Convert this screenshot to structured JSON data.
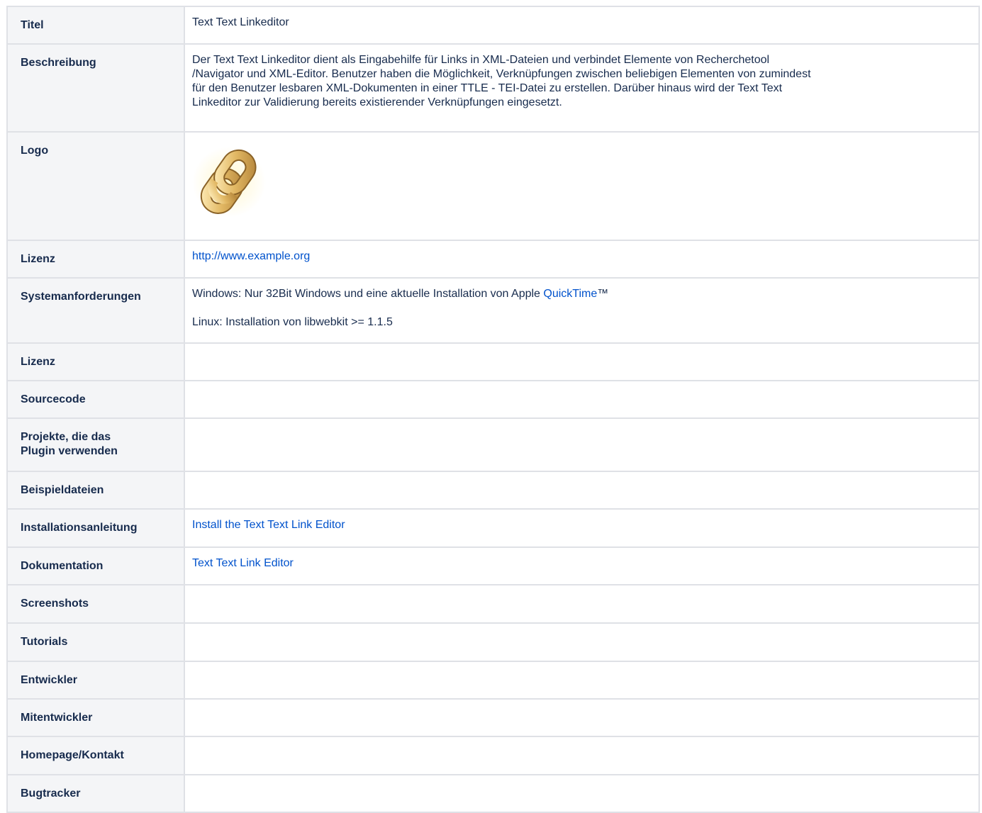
{
  "rows": {
    "titel": {
      "key": "Titel",
      "value": "Text Text Linkeditor"
    },
    "beschreibung": {
      "key": "Beschreibung",
      "value_line1": "Der Text Text Linkeditor dient als Eingabehilfe für Links in XML-Dateien und verbindet Elemente von Recherchetool",
      "value_line2": "/Navigator und XML-Editor. Benutzer haben die Möglichkeit, Verknüpfungen zwischen beliebigen Elementen von zumindest",
      "value_line3": "für den Benutzer lesbaren XML-Dokumenten in einer TTLE - TEI-Datei zu erstellen. Darüber hinaus wird der Text Text",
      "value_line4": "Linkeditor zur Validierung bereits existierender Verknüpfungen eingesetzt."
    },
    "logo": {
      "key": "Logo",
      "icon": "chain-link-icon"
    },
    "lizenz1": {
      "key": "Lizenz",
      "link": "http://www.example.org"
    },
    "system": {
      "key": "Systemanforderungen",
      "windows_prefix": "Windows: Nur 32Bit Windows und eine aktuelle Installation von Apple ",
      "windows_link": "QuickTime",
      "windows_suffix": "™",
      "linux": "Linux: Installation von libwebkit >= 1.1.5"
    },
    "lizenz2": {
      "key": "Lizenz"
    },
    "sourcecode": {
      "key": "Sourcecode"
    },
    "projekte": {
      "key_line1": "Projekte, die das",
      "key_line2": "Plugin verwenden"
    },
    "beispiel": {
      "key": "Beispieldateien"
    },
    "installation": {
      "key": "Installationsanleitung",
      "link": "Install the Text Text Link Editor"
    },
    "dokumentation": {
      "key": "Dokumentation",
      "link": "Text Text Link Editor"
    },
    "screenshots": {
      "key": "Screenshots"
    },
    "tutorials": {
      "key": "Tutorials"
    },
    "entwickler": {
      "key": "Entwickler"
    },
    "mitentwickler": {
      "key": "Mitentwickler"
    },
    "homepage": {
      "key": "Homepage/Kontakt"
    },
    "bugtracker": {
      "key": "Bugtracker"
    }
  },
  "colors": {
    "header_bg": "#f4f5f7",
    "border": "#dfe1e6",
    "link": "#0052cc",
    "text": "#172b4d"
  }
}
